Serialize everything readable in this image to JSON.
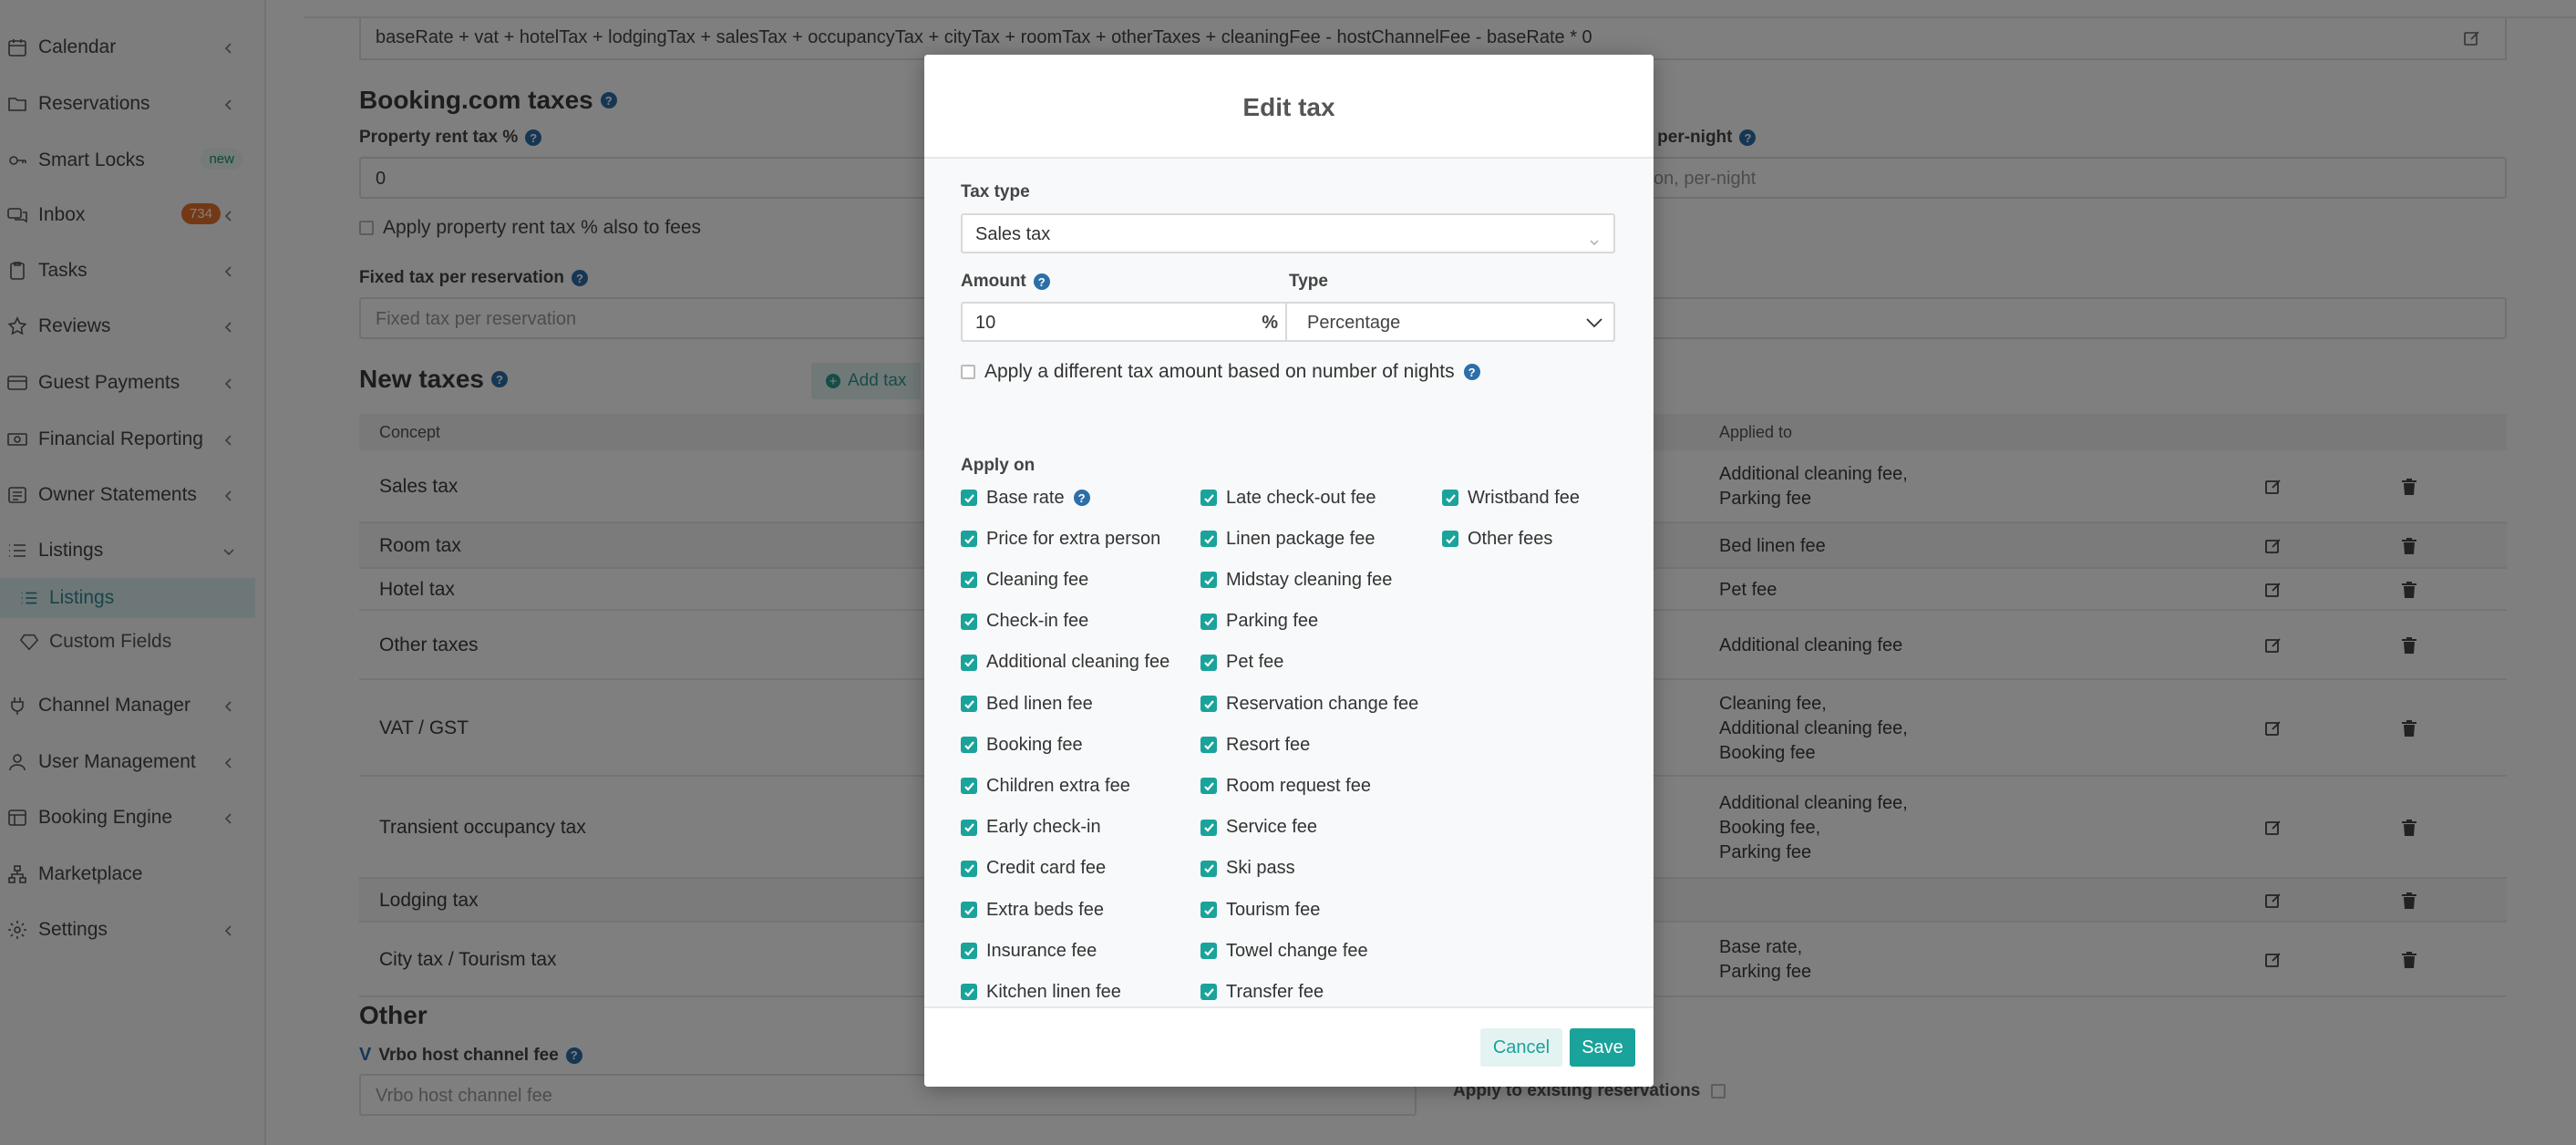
{
  "sidebar": {
    "items": [
      {
        "label": "Calendar"
      },
      {
        "label": "Reservations"
      },
      {
        "label": "Smart Locks",
        "badge": "new"
      },
      {
        "label": "Inbox",
        "badge": "734"
      },
      {
        "label": "Tasks"
      },
      {
        "label": "Reviews"
      },
      {
        "label": "Guest Payments"
      },
      {
        "label": "Financial Reporting"
      },
      {
        "label": "Owner Statements"
      },
      {
        "label": "Listings"
      },
      {
        "label": "Channel Manager"
      },
      {
        "label": "User Management"
      },
      {
        "label": "Booking Engine"
      },
      {
        "label": "Marketplace"
      },
      {
        "label": "Settings"
      }
    ],
    "subitems": [
      {
        "label": "Listings"
      },
      {
        "label": "Custom Fields"
      }
    ]
  },
  "main": {
    "formula": "baseRate + vat + hotelTax + lodgingTax + salesTax + occupancyTax + cityTax + roomTax + otherTaxes + cleaningFee - hostChannelFee - baseRate * 0",
    "booking_title": "Booking.com taxes",
    "rent_tax_label": "Property rent tax %",
    "rent_tax_value": "0",
    "right_label_tail": "n, per-night",
    "right_placeholder_tail": "son, per-night",
    "apply_rent_fees": "Apply property rent tax % also to fees",
    "fixed_tax_label": "Fixed tax per reservation",
    "fixed_tax_placeholder": "Fixed tax per reservation",
    "new_taxes_title": "New taxes",
    "add_tax": "Add tax",
    "table": {
      "col_concept": "Concept",
      "col_applied": "Applied to",
      "rows": [
        {
          "concept": "Sales tax",
          "applied": [
            "Additional cleaning fee,",
            "Parking fee"
          ]
        },
        {
          "concept": "Room tax",
          "applied": [
            "Bed linen fee"
          ]
        },
        {
          "concept": "Hotel tax",
          "applied": [
            "Pet fee"
          ]
        },
        {
          "concept": "Other taxes",
          "applied": [
            "Additional cleaning fee"
          ]
        },
        {
          "concept": "VAT / GST",
          "applied": [
            "Cleaning fee,",
            "Additional cleaning fee,",
            "Booking fee"
          ]
        },
        {
          "concept": "Transient occupancy tax",
          "applied": [
            "Additional cleaning fee,",
            "Booking fee,",
            "Parking fee"
          ]
        },
        {
          "concept": "Lodging tax",
          "applied": []
        },
        {
          "concept": "City tax / Tourism tax",
          "applied": [
            "Base rate,",
            "Parking fee"
          ]
        }
      ]
    },
    "other_title": "Other",
    "vrbo_label": "Vrbo host channel fee",
    "vrbo_placeholder": "Vrbo host channel fee",
    "apply_existing": "Apply to existing reservations"
  },
  "modal": {
    "title": "Edit tax",
    "tax_type_label": "Tax type",
    "tax_type_value": "Sales tax",
    "amount_label": "Amount",
    "amount_value": "10",
    "amount_unit": "%",
    "type_label": "Type",
    "type_value": "Percentage",
    "diff_nights": "Apply a different tax amount based on number of nights",
    "apply_on_label": "Apply on",
    "fees_col1": [
      "Base rate",
      "Price for extra person",
      "Cleaning fee",
      "Check-in fee",
      "Additional cleaning fee",
      "Bed linen fee",
      "Booking fee",
      "Children extra fee",
      "Early check-in",
      "Credit card fee",
      "Extra beds fee",
      "Insurance fee",
      "Kitchen linen fee"
    ],
    "fees_col2": [
      "Late check-out fee",
      "Linen package fee",
      "Midstay cleaning fee",
      "Parking fee",
      "Pet fee",
      "Reservation change fee",
      "Resort fee",
      "Room request fee",
      "Service fee",
      "Ski pass",
      "Tourism fee",
      "Towel change fee",
      "Transfer fee"
    ],
    "fees_col3": [
      "Wristband fee",
      "Other fees"
    ],
    "cancel": "Cancel",
    "save": "Save"
  },
  "colors": {
    "accent": "#1aa39a",
    "badge_orange": "#e8702a",
    "active_bg": "#dceff0"
  }
}
